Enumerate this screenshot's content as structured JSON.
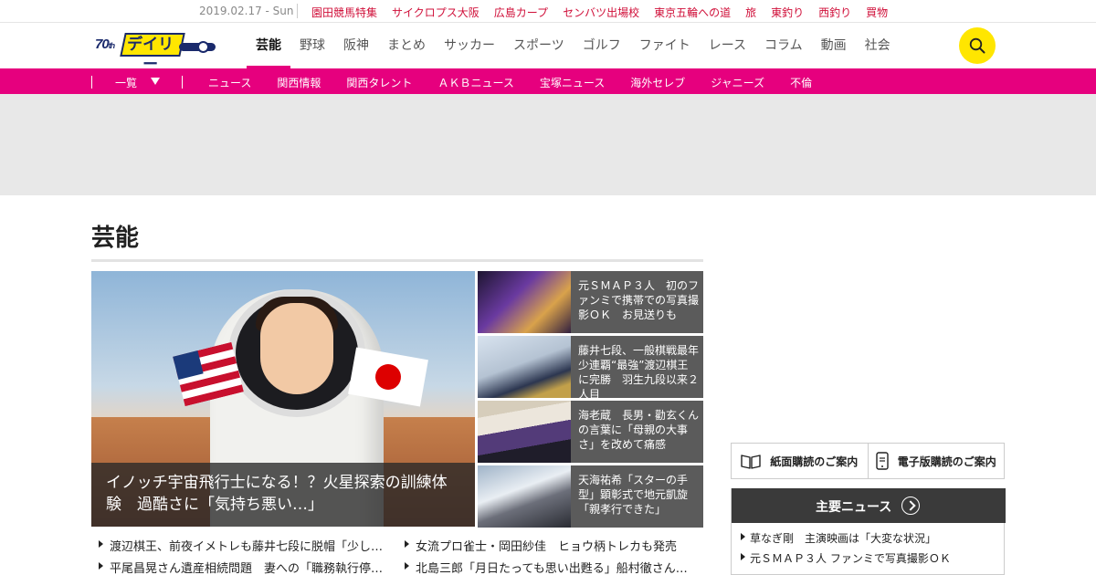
{
  "topbar": {
    "date": "2019.02.17 - Sun",
    "links": [
      "園田競馬特集",
      "サイクロプス大阪",
      "広島カープ",
      "センバツ出場校",
      "東京五輪への道",
      "旅",
      "東釣り",
      "西釣り",
      "買物"
    ]
  },
  "header": {
    "logo_text": "デイリー",
    "logo_anniversary": "70",
    "logo_anniversary_suffix": "th",
    "nav": [
      "芸能",
      "野球",
      "阪神",
      "まとめ",
      "サッカー",
      "スポーツ",
      "ゴルフ",
      "ファイト",
      "レース",
      "コラム",
      "動画",
      "社会"
    ],
    "active_nav_index": 0
  },
  "subnav": {
    "all_label": "一覧",
    "links": [
      "ニュース",
      "関西情報",
      "関西タレント",
      "ＡＫＢニュース",
      "宝塚ニュース",
      "海外セレブ",
      "ジャニーズ",
      "不倫"
    ]
  },
  "main": {
    "section_title": "芸能",
    "hero": {
      "caption": "イノッチ宇宙飛行士になる！？火星探索の訓練体験　過酷さに「気持ち悪い…」"
    },
    "side_stories": [
      {
        "title": "元ＳＭＡＰ３人　初のファンミで携帯での写真撮影ＯＫ　お見送りも"
      },
      {
        "title": "藤井七段、一般棋戦最年少連覇“最強”渡辺棋王に完勝　羽生九段以来２人目"
      },
      {
        "title": "海老蔵　長男・勸玄くんの言葉に「母親の大事さ」を改めて痛感"
      },
      {
        "title": "天海祐希「スターの手型」顕彰式で地元凱旋「親孝行できた」"
      }
    ],
    "headlines": [
      [
        "渡辺棋王、前夜イメトレも藤井七段に脱帽「少し…",
        "女流プロ雀士・岡田紗佳　ヒョウ柄トレカも発売"
      ],
      [
        "平尾昌晃さん遺産相続問題　妻への「職務執行停…",
        "北島三郎「月日たっても思い出甦る」船村徹さん…"
      ]
    ]
  },
  "sidebar": {
    "paper_subscription": "紙面購読のご案内",
    "digital_subscription": "電子版購読のご案内",
    "major_news_title": "主要ニュース",
    "major_news": [
      "草なぎ剛　主演映画は「大変な状況」",
      "元ＳＭＡＰ３人 ファンミで写真撮影ＯＫ"
    ]
  },
  "colors": {
    "accent_pink": "#e6007e",
    "link_red": "#d0103a",
    "search_yellow": "#ffe600"
  }
}
